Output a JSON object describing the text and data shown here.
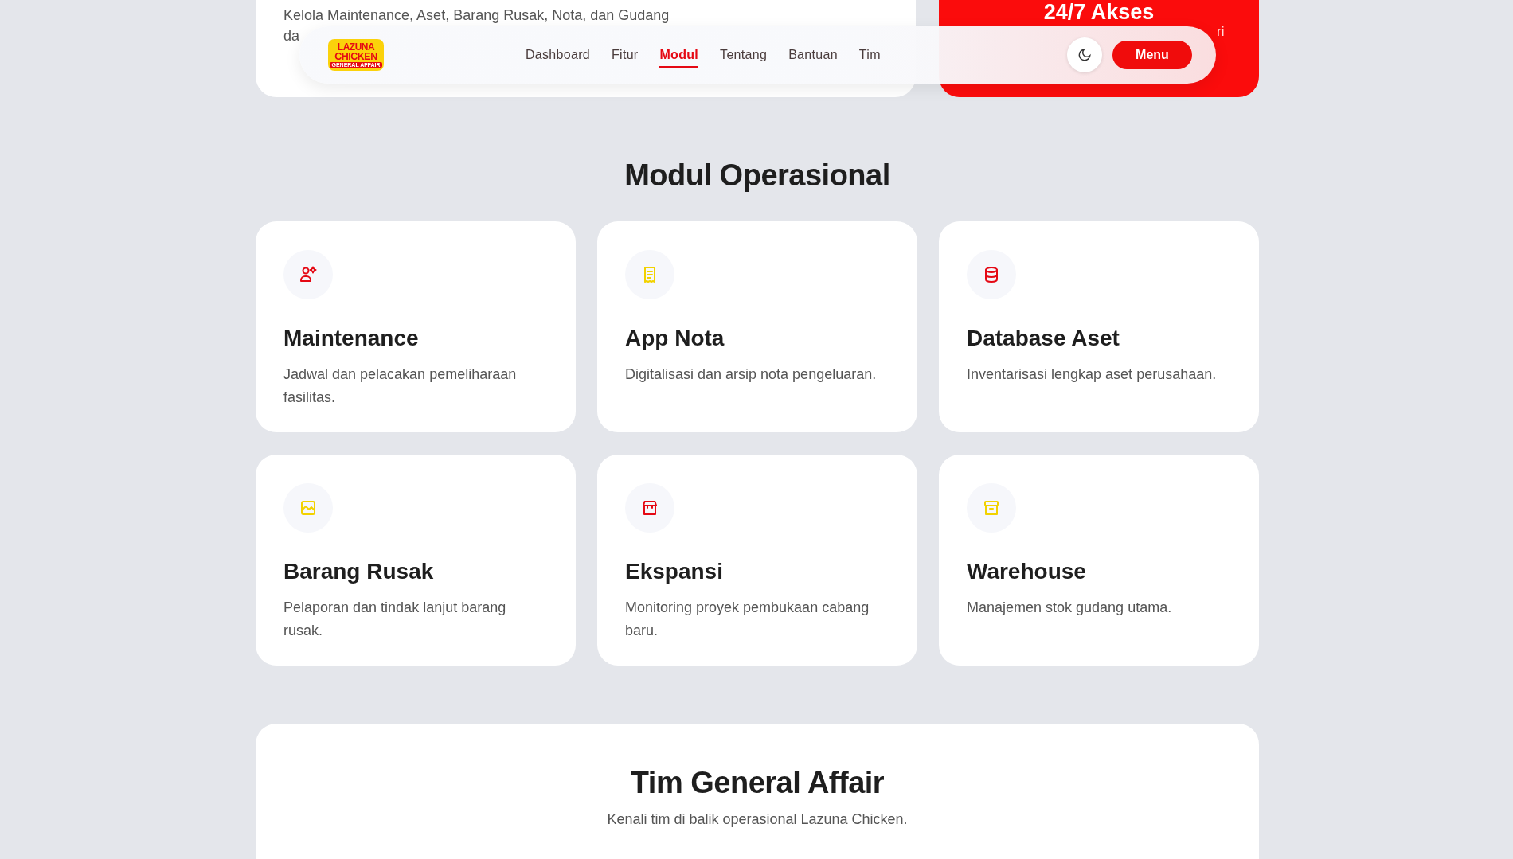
{
  "hero": {
    "description_line": "Kelola Maintenance, Aset, Barang Rusak, Nota, dan Gudang",
    "description_fragment": "da",
    "access_title": "24/7 Akses",
    "access_fragment": "ri"
  },
  "navbar": {
    "logo": {
      "line_1": "LAZUNA",
      "line_2": "CHICKEN",
      "line_3": "GENERAL AFFAIR"
    },
    "links": [
      {
        "label": "Dashboard",
        "selected": false
      },
      {
        "label": "Fitur",
        "selected": false
      },
      {
        "label": "Modul",
        "selected": true
      },
      {
        "label": "Tentang",
        "selected": false
      },
      {
        "label": "Bantuan",
        "selected": false
      },
      {
        "label": "Tim",
        "selected": false
      }
    ],
    "menu_button": "Menu"
  },
  "modules": {
    "title": "Modul Operasional",
    "items": [
      {
        "title": "Maintenance",
        "description": "Jadwal dan pelacakan pemeliharaan fasilitas.",
        "color": "#e50914"
      },
      {
        "title": "App Nota",
        "description": "Digitalisasi dan arsip nota pengeluaran.",
        "color": "#f2d200"
      },
      {
        "title": "Database Aset",
        "description": "Inventarisasi lengkap aset perusahaan.",
        "color": "#e50914"
      },
      {
        "title": "Barang Rusak",
        "description": "Pelaporan dan tindak lanjut barang rusak.",
        "color": "#f2d200"
      },
      {
        "title": "Ekspansi",
        "description": "Monitoring proyek pembukaan cabang baru.",
        "color": "#e50914"
      },
      {
        "title": "Warehouse",
        "description": "Manajemen stok gudang utama.",
        "color": "#f2d200"
      }
    ]
  },
  "team": {
    "title": "Tim General Affair",
    "subtitle": "Kenali tim di balik operasional Lazuna Chicken."
  }
}
